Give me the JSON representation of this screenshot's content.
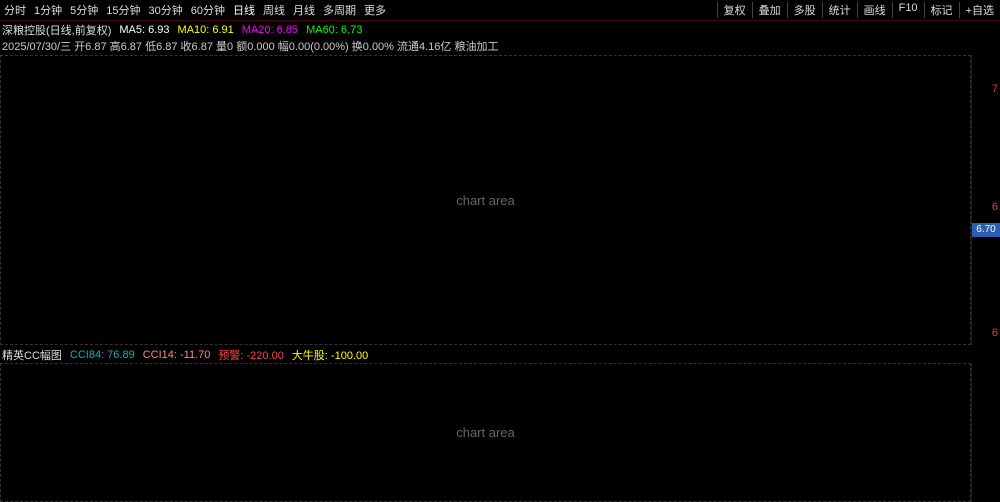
{
  "toolbar": {
    "intervals": [
      "分时",
      "1分钟",
      "5分钟",
      "15分钟",
      "30分钟",
      "60分钟",
      "日线",
      "周线",
      "月线",
      "多周期",
      "更多"
    ],
    "buttons": [
      "复权",
      "叠加",
      "多股",
      "统计",
      "画线",
      "F10",
      "标记",
      "+自选"
    ]
  },
  "info1": {
    "title": "深粮控股(日线,前复权)",
    "ma5": "MA5: 6.93",
    "ma10": "MA10: 6.91",
    "ma20": "MA20: 6.85",
    "ma60": "MA60: 6.73"
  },
  "info2": {
    "text": "2025/07/30/三 开6.87 高6.87 低6.87 收6.87 量0 额0.000 幅0.00(0.00%) 换0.00% 流通4.16亿 粮油加工"
  },
  "sub": {
    "title": "精英CC幅图",
    "cci84": "CCI84: 76.89",
    "cci14": "CCI14: -11.70",
    "warn": "预警: -220.00",
    "bull": "大牛股: -100.00"
  },
  "axis": {
    "top": "7",
    "mid": "6",
    "low": "6",
    "last": "6.70"
  },
  "placeholder": "chart area"
}
